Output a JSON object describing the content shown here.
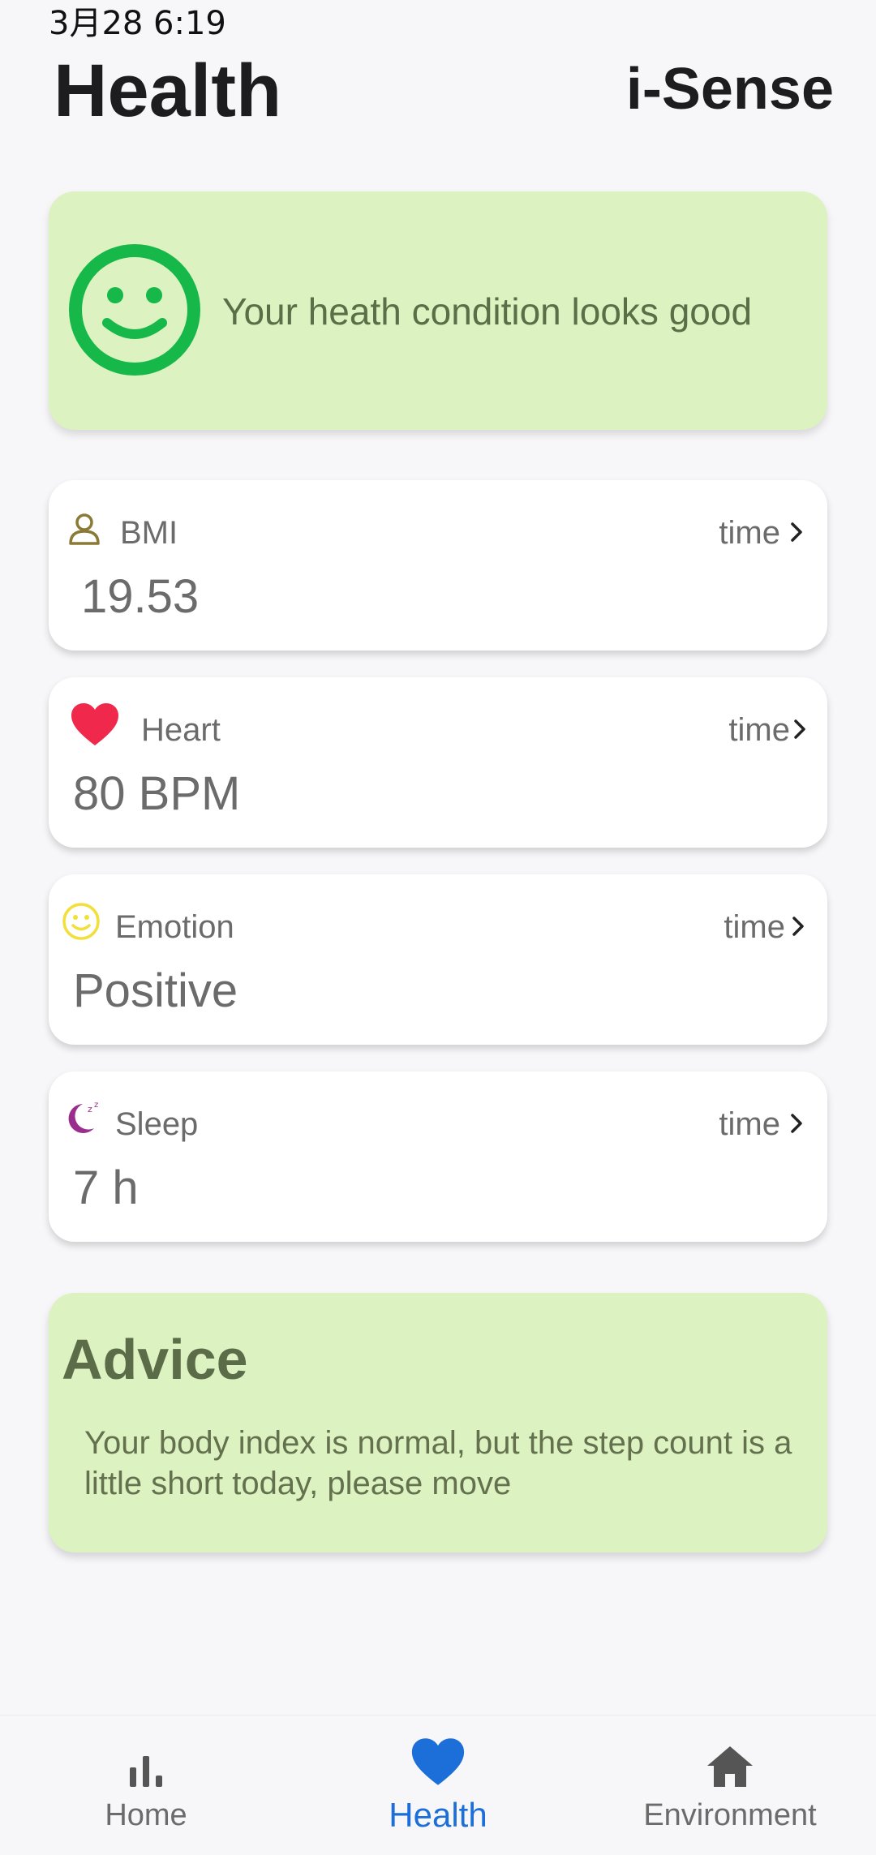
{
  "status_bar": {
    "time": "3月28 6:19"
  },
  "header": {
    "title": "Health",
    "brand": "i-Sense"
  },
  "status_card": {
    "icon": "smile-face-icon",
    "message": "Your heath condition looks good",
    "color": "#16b84a"
  },
  "metrics": [
    {
      "icon": "person-icon",
      "label": "BMI",
      "time_label": "time",
      "value": "19.53"
    },
    {
      "icon": "heart-icon",
      "label": "Heart",
      "time_label": "time",
      "value": "80 BPM"
    },
    {
      "icon": "emotion-smile-icon",
      "label": "Emotion",
      "time_label": "time",
      "value": "Positive"
    },
    {
      "icon": "sleep-moon-icon",
      "label": "Sleep",
      "time_label": "time",
      "value": "7 h"
    }
  ],
  "advice": {
    "title": "Advice",
    "text": "Your body index is normal, but the step count is a little short today, please move"
  },
  "tabbar": {
    "tabs": [
      {
        "icon": "bar-chart-icon",
        "label": "Home",
        "active": false
      },
      {
        "icon": "heart-icon",
        "label": "Health",
        "active": true
      },
      {
        "icon": "house-icon",
        "label": "Environment",
        "active": false
      }
    ]
  },
  "colors": {
    "accent_blue": "#1c6fd8",
    "card_green": "#dcf2c0",
    "heart_red": "#f0294c",
    "emotion_yellow": "#f2df3a",
    "sleep_purple": "#9a2e8c",
    "bmi_olive": "#8a7a35"
  }
}
